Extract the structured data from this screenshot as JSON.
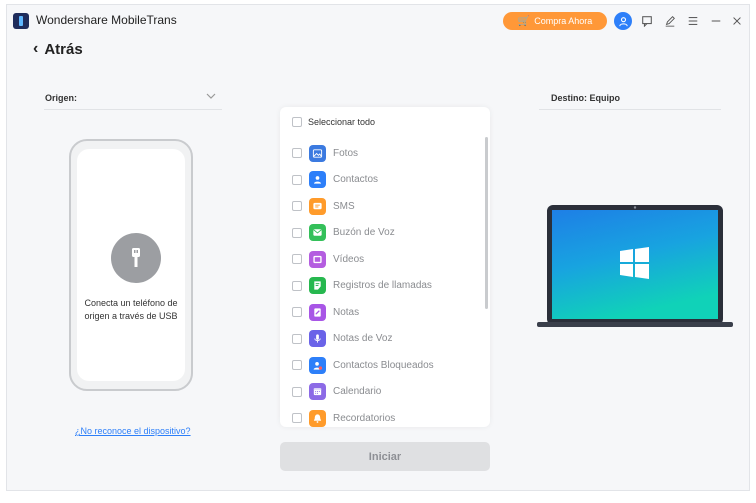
{
  "app": {
    "title": "Wondershare MobileTrans"
  },
  "titlebar": {
    "buy_label": "Compra Ahora",
    "accent": "#ff9838"
  },
  "nav": {
    "back_label": "Atrás"
  },
  "origin": {
    "label": "Origen:"
  },
  "phone": {
    "connect_text": "Conecta un teléfono de origen a través de USB",
    "help_link": "¿No reconoce el dispositivo?"
  },
  "list": {
    "select_all": "Seleccionar todo",
    "items": [
      {
        "label": "Fotos",
        "icon": "photos-icon",
        "color": "#3b7ae0"
      },
      {
        "label": "Contactos",
        "icon": "contacts-icon",
        "color": "#2d7ff9"
      },
      {
        "label": "SMS",
        "icon": "sms-icon",
        "color": "#ff9b2b"
      },
      {
        "label": "Buzón de Voz",
        "icon": "voicemail-icon",
        "color": "#34c05a"
      },
      {
        "label": "Vídeos",
        "icon": "videos-icon",
        "color": "#b45de0"
      },
      {
        "label": "Registros de llamadas",
        "icon": "call-log-icon",
        "color": "#27b84f"
      },
      {
        "label": "Notas",
        "icon": "notes-icon",
        "color": "#a856e6"
      },
      {
        "label": "Notas de Voz",
        "icon": "voice-notes-icon",
        "color": "#6a63e8"
      },
      {
        "label": "Contactos Bloqueados",
        "icon": "blocked-contacts-icon",
        "color": "#2d7ff9"
      },
      {
        "label": "Calendario",
        "icon": "calendar-icon",
        "color": "#8c6ae6"
      },
      {
        "label": "Recordatorios",
        "icon": "reminders-icon",
        "color": "#ff9b2b"
      }
    ]
  },
  "actions": {
    "start_label": "Iniciar"
  },
  "destination": {
    "label": "Destino: Equipo"
  }
}
